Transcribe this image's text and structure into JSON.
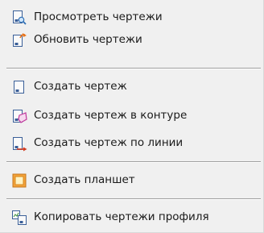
{
  "menu": {
    "items": [
      {
        "label": "Просмотреть чертежи",
        "icon": "view-drawings-icon"
      },
      {
        "label": "Обновить чертежи",
        "icon": "refresh-drawings-icon"
      },
      {
        "label": "Создать чертеж",
        "icon": "create-drawing-icon"
      },
      {
        "label": "Создать чертеж в контуре",
        "icon": "create-drawing-in-contour-icon"
      },
      {
        "label": "Создать чертеж по линии",
        "icon": "create-drawing-along-line-icon"
      },
      {
        "label": "Создать планшет",
        "icon": "create-tablet-icon"
      },
      {
        "label": "Копировать чертежи профиля",
        "icon": "copy-profile-drawings-icon"
      }
    ]
  }
}
